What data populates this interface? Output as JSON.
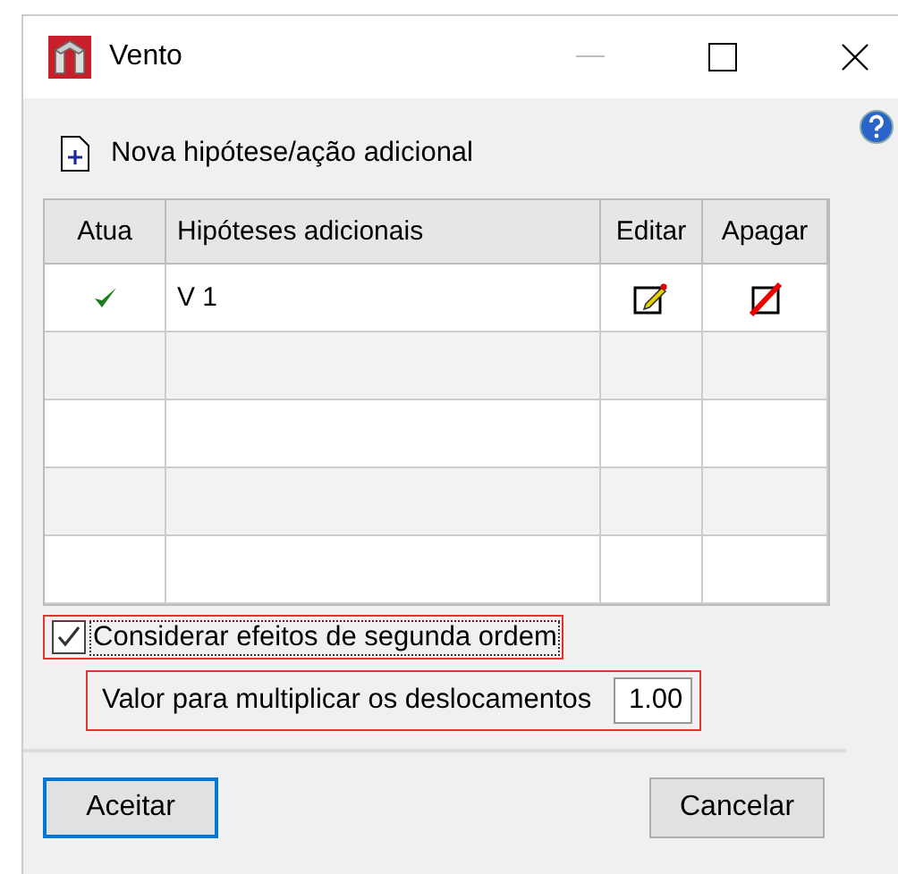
{
  "window": {
    "title": "Vento"
  },
  "new_action": {
    "label": "Nova hipótese/ação adicional"
  },
  "table": {
    "columns": [
      "Atua",
      "Hipóteses adicionais",
      "Editar",
      "Apagar"
    ],
    "rows": [
      {
        "active": true,
        "name": "V 1",
        "editable": true,
        "deletable": true
      },
      {
        "active": false,
        "name": "",
        "editable": false,
        "deletable": false
      },
      {
        "active": false,
        "name": "",
        "editable": false,
        "deletable": false
      },
      {
        "active": false,
        "name": "",
        "editable": false,
        "deletable": false
      },
      {
        "active": false,
        "name": "",
        "editable": false,
        "deletable": false
      }
    ]
  },
  "second_order": {
    "label": "Considerar efeitos de segunda ordem",
    "checked": true,
    "highlighted": true
  },
  "multiplier": {
    "label": "Valor para multiplicar os deslocamentos",
    "value": "1.00",
    "highlighted": true
  },
  "buttons": [
    {
      "label": "Aceitar",
      "default": true
    },
    {
      "label": "Cancelar",
      "default": false
    }
  ]
}
